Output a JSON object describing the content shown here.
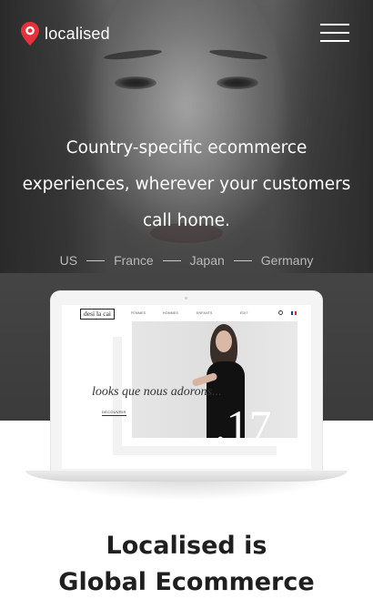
{
  "header": {
    "brand": "localised",
    "menu_icon": "hamburger-icon",
    "logo_icon": "map-pin-icon"
  },
  "hero": {
    "headline_lines": [
      "Country-specific ecommerce",
      "experiences, wherever your customers",
      "call home."
    ],
    "countries": [
      "US",
      "France",
      "Japan",
      "Germany"
    ]
  },
  "mockup": {
    "site_logo": "desi la cai",
    "nav_links": [
      "FEMMES",
      "HOMMES",
      "ENFANTS",
      "EDIT"
    ],
    "tagline": "looks que nous adorons...",
    "cta": "DÉCOUVRIR",
    "number": ".17",
    "flag_colors": [
      "#1f3f99",
      "#ffffff",
      "#d42b2b"
    ]
  },
  "section": {
    "title_lines": [
      "Localised is",
      "Global Ecommerce"
    ]
  },
  "colors": {
    "accent": "#e8303a",
    "text_dark": "#1f1f1f"
  }
}
